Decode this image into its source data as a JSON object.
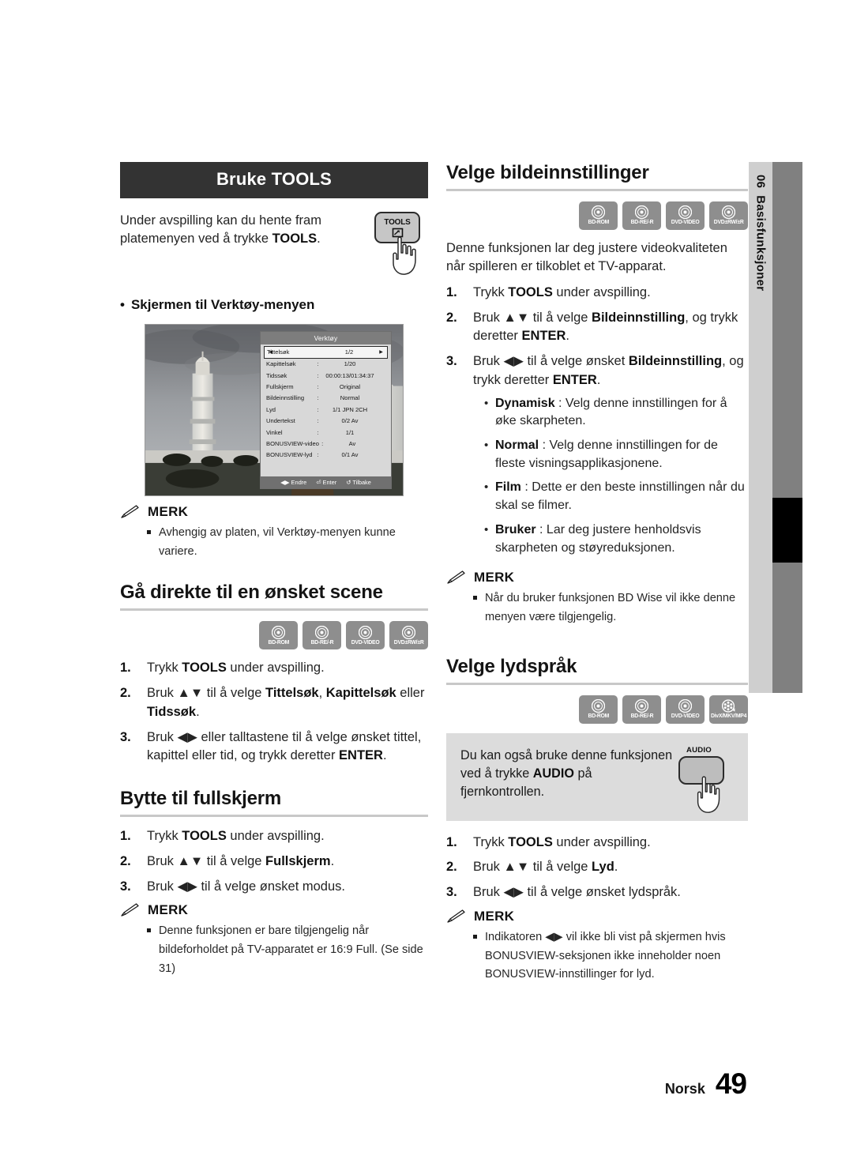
{
  "chapter_tab": {
    "number": "06",
    "label": "Basisfunksjoner"
  },
  "footer": {
    "language": "Norsk",
    "page": "49"
  },
  "left": {
    "banner": "Bruke TOOLS",
    "intro_line1": "Under avspilling kan du hente fram",
    "intro_line2_pre": "platemenyen ved å trykke ",
    "intro_line2_bold": "TOOLS",
    "intro_line2_post": ".",
    "tools_key": "TOOLS",
    "bullet_heading": "Skjermen til Verktøy-menyen",
    "osd": {
      "title": "Verktøy",
      "rows": [
        {
          "key": "Tittelsøk",
          "sep": "",
          "value": "1/2",
          "selected": true
        },
        {
          "key": "Kapittelsøk",
          "sep": ":",
          "value": "1/20",
          "selected": false
        },
        {
          "key": "Tidssøk",
          "sep": ":",
          "value": "00:00:13/01:34:37",
          "selected": false
        },
        {
          "key": "Fullskjerm",
          "sep": ":",
          "value": "Original",
          "selected": false
        },
        {
          "key": "Bildeinnstilling",
          "sep": ":",
          "value": "Normal",
          "selected": false
        },
        {
          "key": "Lyd",
          "sep": ":",
          "value": "1/1 JPN 2CH",
          "selected": false
        },
        {
          "key": "Undertekst",
          "sep": ":",
          "value": "0/2 Av",
          "selected": false
        },
        {
          "key": "Vinkel",
          "sep": ":",
          "value": "1/1",
          "selected": false
        },
        {
          "key": "BONUSVIEW-video",
          "sep": ":",
          "value": "Av",
          "selected": false
        },
        {
          "key": "BONUSVIEW-lyd",
          "sep": ":",
          "value": "0/1 Av",
          "selected": false
        }
      ],
      "footer_endre": "Endre",
      "footer_enter": "Enter",
      "footer_tilbake": "Tilbake"
    },
    "note1": {
      "label": "MERK",
      "text": "Avhengig av platen, vil Verktøy-menyen kunne variere."
    },
    "sec_scene": {
      "heading": "Gå direkte til en ønsket scene",
      "badges": [
        {
          "name": "BD-ROM",
          "icon": "disc-icon"
        },
        {
          "name": "BD-RE/-R",
          "icon": "disc-icon"
        },
        {
          "name": "DVD-VIDEO",
          "icon": "disc-icon"
        },
        {
          "name": "DVD±RW/±R",
          "icon": "disc-icon"
        }
      ],
      "step1_pre": "Trykk ",
      "step1_bold": "TOOLS",
      "step1_post": " under avspilling.",
      "step2_pre": "Bruk ▲▼ til å velge ",
      "step2_b1": "Tittelsøk",
      "step2_mid": ", ",
      "step2_b2": "Kapittelsøk",
      "step2_mid2": " eller ",
      "step2_b3": "Tidssøk",
      "step2_post": ".",
      "step3_pre": "Bruk ◀▶ eller talltastene til å velge ønsket tittel, kapittel eller tid, og trykk deretter ",
      "step3_bold": "ENTER",
      "step3_post": "."
    },
    "sec_full": {
      "heading": "Bytte til fullskjerm",
      "step1_pre": "Trykk ",
      "step1_bold": "TOOLS",
      "step1_post": " under avspilling.",
      "step2_pre": "Bruk ▲▼ til å velge ",
      "step2_bold": "Fullskjerm",
      "step2_post": ".",
      "step3": "Bruk ◀▶ til å velge ønsket modus.",
      "note": {
        "label": "MERK",
        "text": "Denne funksjonen er bare tilgjengelig når bildeforholdet på TV-apparatet er 16:9 Full. (Se side 31)"
      }
    }
  },
  "right": {
    "sec_picture": {
      "heading": "Velge bildeinnstillinger",
      "badges": [
        {
          "name": "BD-ROM",
          "icon": "disc-icon"
        },
        {
          "name": "BD-RE/-R",
          "icon": "disc-icon"
        },
        {
          "name": "DVD-VIDEO",
          "icon": "disc-icon"
        },
        {
          "name": "DVD±RW/±R",
          "icon": "disc-icon"
        }
      ],
      "intro": "Denne funksjonen lar deg justere videokvaliteten når spilleren er tilkoblet et TV-apparat.",
      "step1_pre": "Trykk ",
      "step1_bold": "TOOLS",
      "step1_post": " under avspilling.",
      "step2_pre": "Bruk ▲▼ til å velge ",
      "step2_bold": "Bildeinnstilling",
      "step2_mid": ", og trykk deretter ",
      "step2_bold2": "ENTER",
      "step2_post": ".",
      "step3_pre": "Bruk ◀▶ til å velge ønsket ",
      "step3_bold": "Bildeinnstilling",
      "step3_mid": ", og trykk deretter ",
      "step3_bold2": "ENTER",
      "step3_post": ".",
      "options": [
        {
          "name": "Dynamisk",
          "desc": " : Velg denne innstillingen for å øke skarpheten."
        },
        {
          "name": "Normal",
          "desc": " : Velg denne innstillingen for de fleste visningsapplikasjonene."
        },
        {
          "name": "Film",
          "desc": " : Dette er den beste innstillingen når du skal se filmer."
        },
        {
          "name": "Bruker",
          "desc": " : Lar deg justere henholdsvis skarpheten og støyreduksjonen."
        }
      ],
      "note": {
        "label": "MERK",
        "text": "Når du bruker funksjonen BD Wise vil ikke denne menyen være tilgjengelig."
      }
    },
    "sec_audio": {
      "heading": "Velge lydspråk",
      "badges": [
        {
          "name": "BD-ROM",
          "icon": "disc-icon"
        },
        {
          "name": "BD-RE/-R",
          "icon": "disc-icon"
        },
        {
          "name": "DVD-VIDEO",
          "icon": "disc-icon"
        },
        {
          "name": "DivX/MKV/MP4",
          "icon": "film-reel-icon"
        }
      ],
      "info_line1": "Du kan også bruke denne funksjonen",
      "info_line2_pre": "ved å trykke ",
      "info_line2_bold": "AUDIO",
      "info_line2_post": " på fjernkontrollen.",
      "audio_key": "AUDIO",
      "step1_pre": "Trykk ",
      "step1_bold": "TOOLS",
      "step1_post": " under avspilling.",
      "step2_pre": "Bruk ▲▼ til å velge ",
      "step2_bold": "Lyd",
      "step2_post": ".",
      "step3": "Bruk ◀▶ til å velge ønsket lydspråk.",
      "note": {
        "label": "MERK",
        "text": "Indikatoren ◀▶ vil ikke bli vist på skjermen hvis BONUSVIEW-seksjonen ikke inneholder noen BONUSVIEW-innstillinger for lyd."
      }
    }
  }
}
